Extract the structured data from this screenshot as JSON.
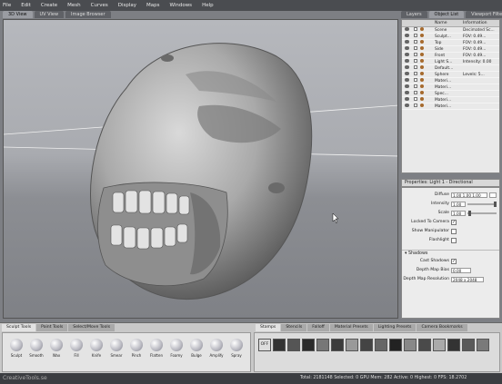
{
  "menu": [
    "File",
    "Edit",
    "Create",
    "Mesh",
    "Curves",
    "Display",
    "Maps",
    "Windows",
    "Help"
  ],
  "view_tabs": [
    {
      "label": "3D View",
      "active": true
    },
    {
      "label": "UV View",
      "active": false
    },
    {
      "label": "Image Browser",
      "active": false
    }
  ],
  "right_tabs": [
    {
      "label": "Layers",
      "active": false
    },
    {
      "label": "Object List",
      "active": true
    },
    {
      "label": "Viewport Filters",
      "active": false
    }
  ],
  "object_list": {
    "headers": [
      "Name",
      "Information"
    ],
    "rows": [
      {
        "name": "Scene",
        "info": "Decimated Sc..."
      },
      {
        "name": "Sculpt...",
        "info": "FOV: 0.49..."
      },
      {
        "name": "Top",
        "info": "FOV: 0.49..."
      },
      {
        "name": "Side",
        "info": "FOV: 0.49..."
      },
      {
        "name": "Front",
        "info": "FOV: 0.49..."
      },
      {
        "name": "Light S...",
        "info": "Intensity: 0.00"
      },
      {
        "name": "Default...",
        "info": ""
      },
      {
        "name": "Sphere",
        "info": "Levels: 5..."
      },
      {
        "name": "Materi...",
        "info": ""
      },
      {
        "name": "Materi...",
        "info": ""
      },
      {
        "name": "Spec...",
        "info": ""
      },
      {
        "name": "Materi...",
        "info": ""
      },
      {
        "name": "Materi...",
        "info": ""
      }
    ]
  },
  "properties": {
    "title": "Properties: Light 1 - Directional",
    "diffuse_label": "Diffuse",
    "diffuse_value": "1.00 1.00 1.00",
    "intensity_label": "Intensity",
    "intensity_value": "1.00",
    "scale_label": "Scale",
    "scale_value": "1.00",
    "locked_label": "Locked To Camera",
    "show_manipulator_label": "Show Manipulator",
    "flashlight_label": "Flashlight",
    "shadows_section": "Shadows",
    "cast_shadows_label": "Cast Shadows",
    "depth_map_bias_label": "Depth Map Bias",
    "depth_map_bias_value": "0.00",
    "depth_map_res_label": "Depth Map Resolution",
    "depth_map_res_value": "2048 x 2048"
  },
  "tools_tabs": [
    {
      "label": "Sculpt Tools",
      "active": true
    },
    {
      "label": "Paint Tools",
      "active": false
    },
    {
      "label": "Select/Move Tools",
      "active": false
    }
  ],
  "tools": [
    "Sculpt",
    "Smooth",
    "Wax",
    "Fill",
    "Knife",
    "Smear",
    "Pinch",
    "Flatten",
    "Foamy",
    "Bulge",
    "Amplify",
    "Spray"
  ],
  "stamp_tabs": [
    {
      "label": "Stamps",
      "active": true
    },
    {
      "label": "Stencils",
      "active": false
    },
    {
      "label": "Falloff",
      "active": false
    },
    {
      "label": "Material Presets",
      "active": false
    },
    {
      "label": "Lighting Presets",
      "active": false
    },
    {
      "label": "Camera Bookmarks",
      "active": false
    }
  ],
  "stamp_off_label": "OFF",
  "status": {
    "left": "CreativeTools.se",
    "right": "Total: 2181148  Selected: 0  GPU Mem: 282  Active: 0  Highest: 0  FPS: 18.2702"
  },
  "colors": {
    "menubar": "#4a4c50",
    "panel": "#e9e9e9",
    "viewport_top": "#b6b8bd"
  }
}
